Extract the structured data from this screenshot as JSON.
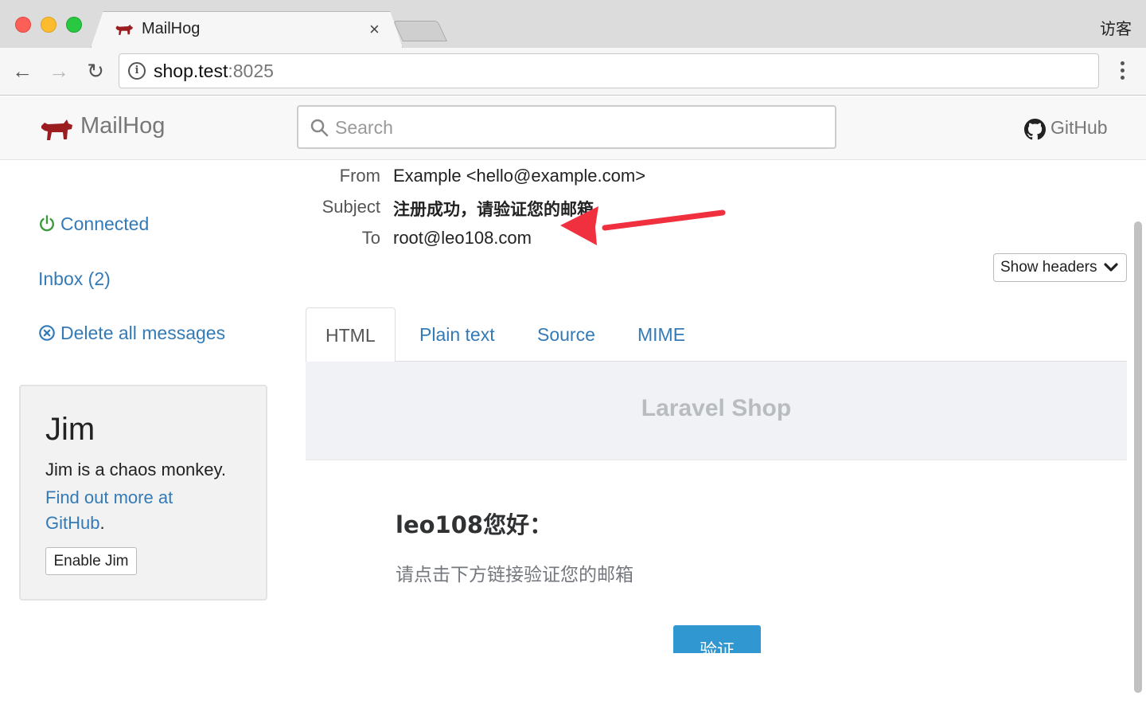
{
  "browser": {
    "tab_title": "MailHog",
    "tab_close": "×",
    "guest_label": "访客",
    "url_host": "shop.test",
    "url_port": ":8025",
    "info_glyph": "i",
    "back_glyph": "←",
    "forward_glyph": "→",
    "reload_glyph": "↻"
  },
  "header": {
    "brand": "MailHog",
    "search_placeholder": "Search",
    "github": "GitHub"
  },
  "sidebar": {
    "connected": "Connected",
    "inbox": "Inbox (2)",
    "delete_all": "Delete all messages"
  },
  "jim": {
    "title": "Jim",
    "description": "Jim is a chaos monkey.",
    "link": "Find out more at GitHub",
    "link_suffix": ".",
    "button": "Enable Jim"
  },
  "message": {
    "labels": {
      "from": "From",
      "subject": "Subject",
      "to": "To"
    },
    "from": "Example <hello@example.com>",
    "subject": "注册成功，请验证您的邮箱",
    "to": "root@leo108.com",
    "show_headers": "Show headers"
  },
  "tabs": [
    "HTML",
    "Plain text",
    "Source",
    "MIME"
  ],
  "active_tab": "HTML",
  "email": {
    "shop_name": "Laravel Shop",
    "greeting": "leo108您好：",
    "body": "请点击下方链接验证您的邮箱",
    "button": "验证"
  },
  "colors": {
    "link": "#337ab7",
    "connected_icon": "#3c9a3c",
    "brand_logo": "#9b1d20",
    "annotation_arrow": "#f0303f",
    "verify_button": "#3097d1"
  },
  "icons": [
    "pig-logo-icon",
    "search-icon",
    "github-icon",
    "power-icon",
    "circle-x-icon",
    "chevron-down-icon",
    "info-icon",
    "arrow-annotation"
  ]
}
